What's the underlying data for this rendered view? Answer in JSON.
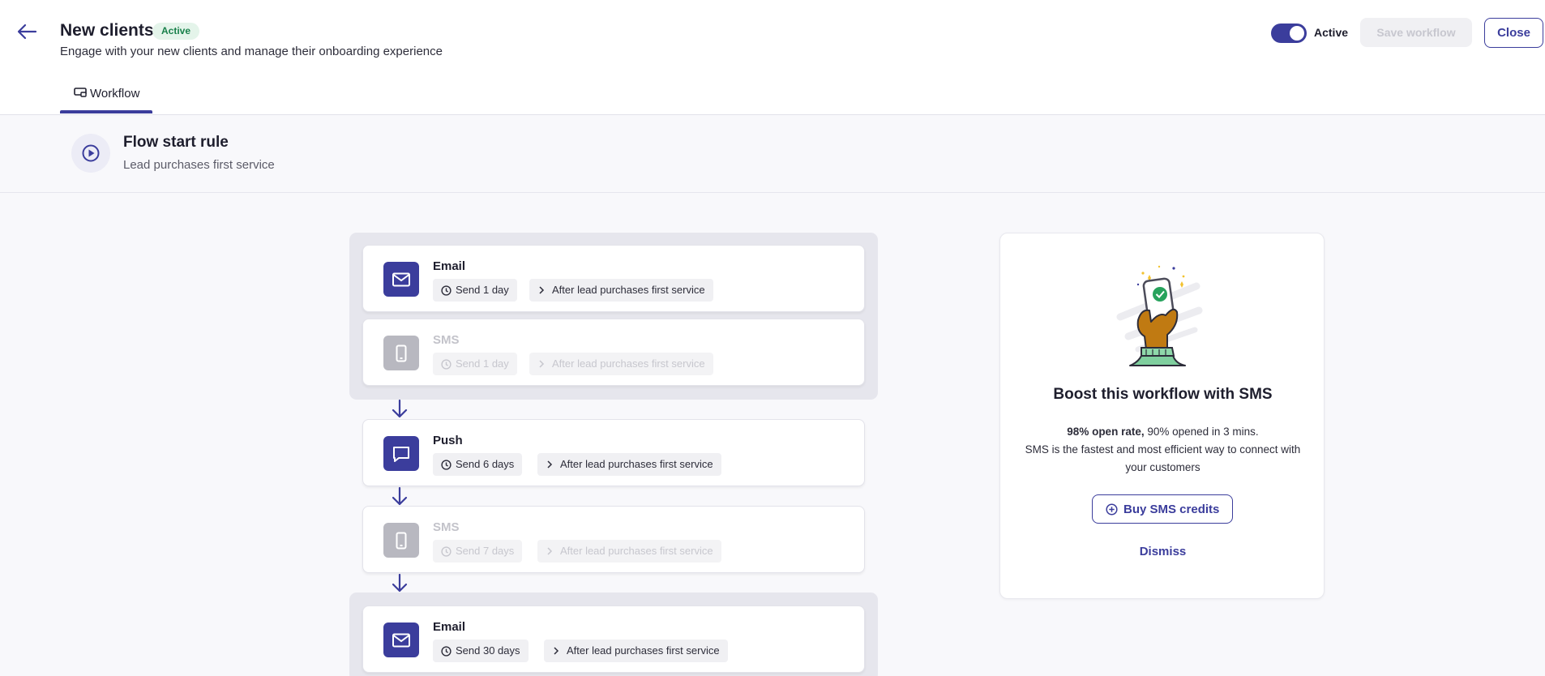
{
  "header": {
    "title": "New clients",
    "status_badge": "Active",
    "subtitle": "Engage with your new clients and manage their onboarding experience",
    "toggle_label": "Active",
    "save_label": "Save workflow",
    "close_label": "Close"
  },
  "tabs": [
    {
      "label": "Workflow"
    }
  ],
  "flow_start": {
    "title": "Flow start rule",
    "subtitle": "Lead purchases first service"
  },
  "steps": [
    {
      "channel": "Email",
      "delay": "Send 1 day",
      "trigger": "After lead purchases first service",
      "enabled": true,
      "icon": "envelope-icon"
    },
    {
      "channel": "SMS",
      "delay": "Send 1 day",
      "trigger": "After lead purchases first service",
      "enabled": false,
      "icon": "phone-icon"
    },
    {
      "channel": "Push",
      "delay": "Send 6 days",
      "trigger": "After lead purchases first service",
      "enabled": true,
      "icon": "chat-bubble-icon"
    },
    {
      "channel": "SMS",
      "delay": "Send 7 days",
      "trigger": "After lead purchases first service",
      "enabled": false,
      "icon": "phone-icon"
    },
    {
      "channel": "Email",
      "delay": "Send 30 days",
      "trigger": "After lead purchases first service",
      "enabled": true,
      "icon": "envelope-icon"
    }
  ],
  "promo": {
    "title": "Boost this workflow with SMS",
    "stat_bold": "98% open rate,",
    "stat_rest": " 90% opened in 3 mins.",
    "description": "SMS is the fastest and most efficient way to connect with your customers",
    "buy_label": "Buy SMS credits",
    "dismiss_label": "Dismiss"
  },
  "colors": {
    "accent": "#3b3d9c",
    "badge_bg": "#e4f4ea",
    "badge_text": "#17804a",
    "disabled_icon": "#b8b8c0"
  }
}
